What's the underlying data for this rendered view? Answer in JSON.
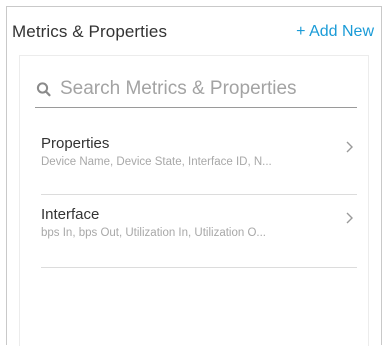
{
  "header": {
    "title": "Metrics & Properties",
    "add_new_label": "+ Add New"
  },
  "search": {
    "placeholder": "Search Metrics & Properties",
    "value": "",
    "icon": "search-icon"
  },
  "list": {
    "items": [
      {
        "title": "Properties",
        "subtitle": "Device Name, Device State, Interface ID, N...",
        "icon": "chevron-right-icon"
      },
      {
        "title": "Interface",
        "subtitle": "bps In, bps Out, Utilization In, Utilization O...",
        "icon": "chevron-right-icon"
      }
    ]
  },
  "colors": {
    "accent": "#1a9bd7",
    "text": "#333333",
    "muted": "#a8a8a8",
    "border": "#c9c9c9"
  }
}
